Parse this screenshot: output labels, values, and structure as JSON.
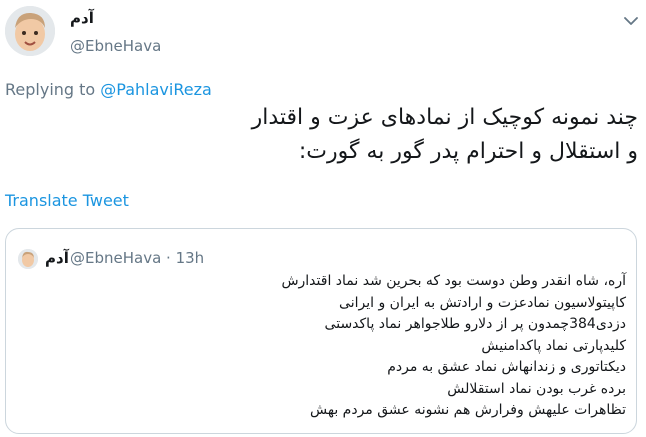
{
  "author": {
    "display_name": "آدم",
    "handle": "@EbneHava"
  },
  "reply": {
    "prefix": "Replying to ",
    "mention": "@PahlaviReza"
  },
  "tweet": {
    "lines": [
      "چند نمونه کوچیک از نمادهای عزت و اقتدار",
      "و استقلال و احترام پدر گور به گورت:"
    ]
  },
  "translate_label": "Translate Tweet",
  "quoted": {
    "display_name": "آدم",
    "handle": "@EbneHava",
    "separator": " · ",
    "time": "13h",
    "lines": [
      "آره، شاه انقدر وطن دوست بود که بحرین شد نماد اقتدارش",
      "کاپیتولاسیون نمادعزت و ارادتش به ایران و ایرانی",
      "دزدی384چمدون پر از دلارو طلاجواهر نماد پاکدستی",
      "کلیدپارتی نماد پاکدامنیش",
      "دیکتاتوری و زندانهاش نماد عشق به مردم",
      "برده غرب بودن نماد استقلالش",
      "تظاهرات علیهش وفرارش هم نشونه عشق مردم بهش"
    ]
  },
  "icons": {
    "menu": "chevron-down-icon",
    "avatar": "avatar-photo"
  },
  "colors": {
    "link": "#1b95e0",
    "secondary_text": "#657786",
    "border": "#ccd6dd"
  }
}
